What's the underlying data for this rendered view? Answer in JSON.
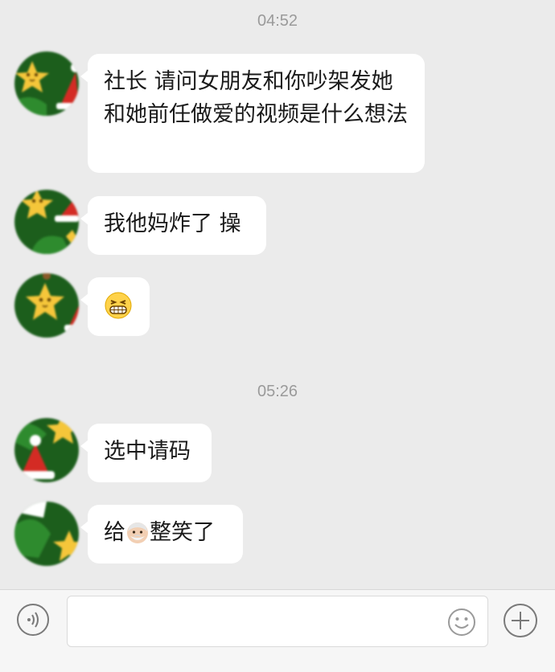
{
  "chat": {
    "groups": [
      {
        "time": "04:52",
        "messages": [
          {
            "text": "社长 请问女朋友和你吵架发她和她前任做爱的视频是什么想法"
          },
          {
            "text": "我他妈炸了 操"
          },
          {
            "emoji": "grin-emoji"
          }
        ]
      },
      {
        "time": "05:26",
        "messages": [
          {
            "text": "选中请码"
          },
          {
            "text_before": "给",
            "emoji": "old-man-emoji",
            "text_after": "整笑了"
          }
        ]
      }
    ]
  },
  "input_bar": {
    "value": "",
    "voice_icon": "voice-icon",
    "emoji_icon": "emoji-icon",
    "plus_icon": "plus-icon"
  },
  "colors": {
    "background": "#ebebeb",
    "bubble": "#ffffff",
    "avatar_green": "#1c5e1c",
    "avatar_star": "#f5c63a",
    "avatar_hat": "#d42b24"
  }
}
